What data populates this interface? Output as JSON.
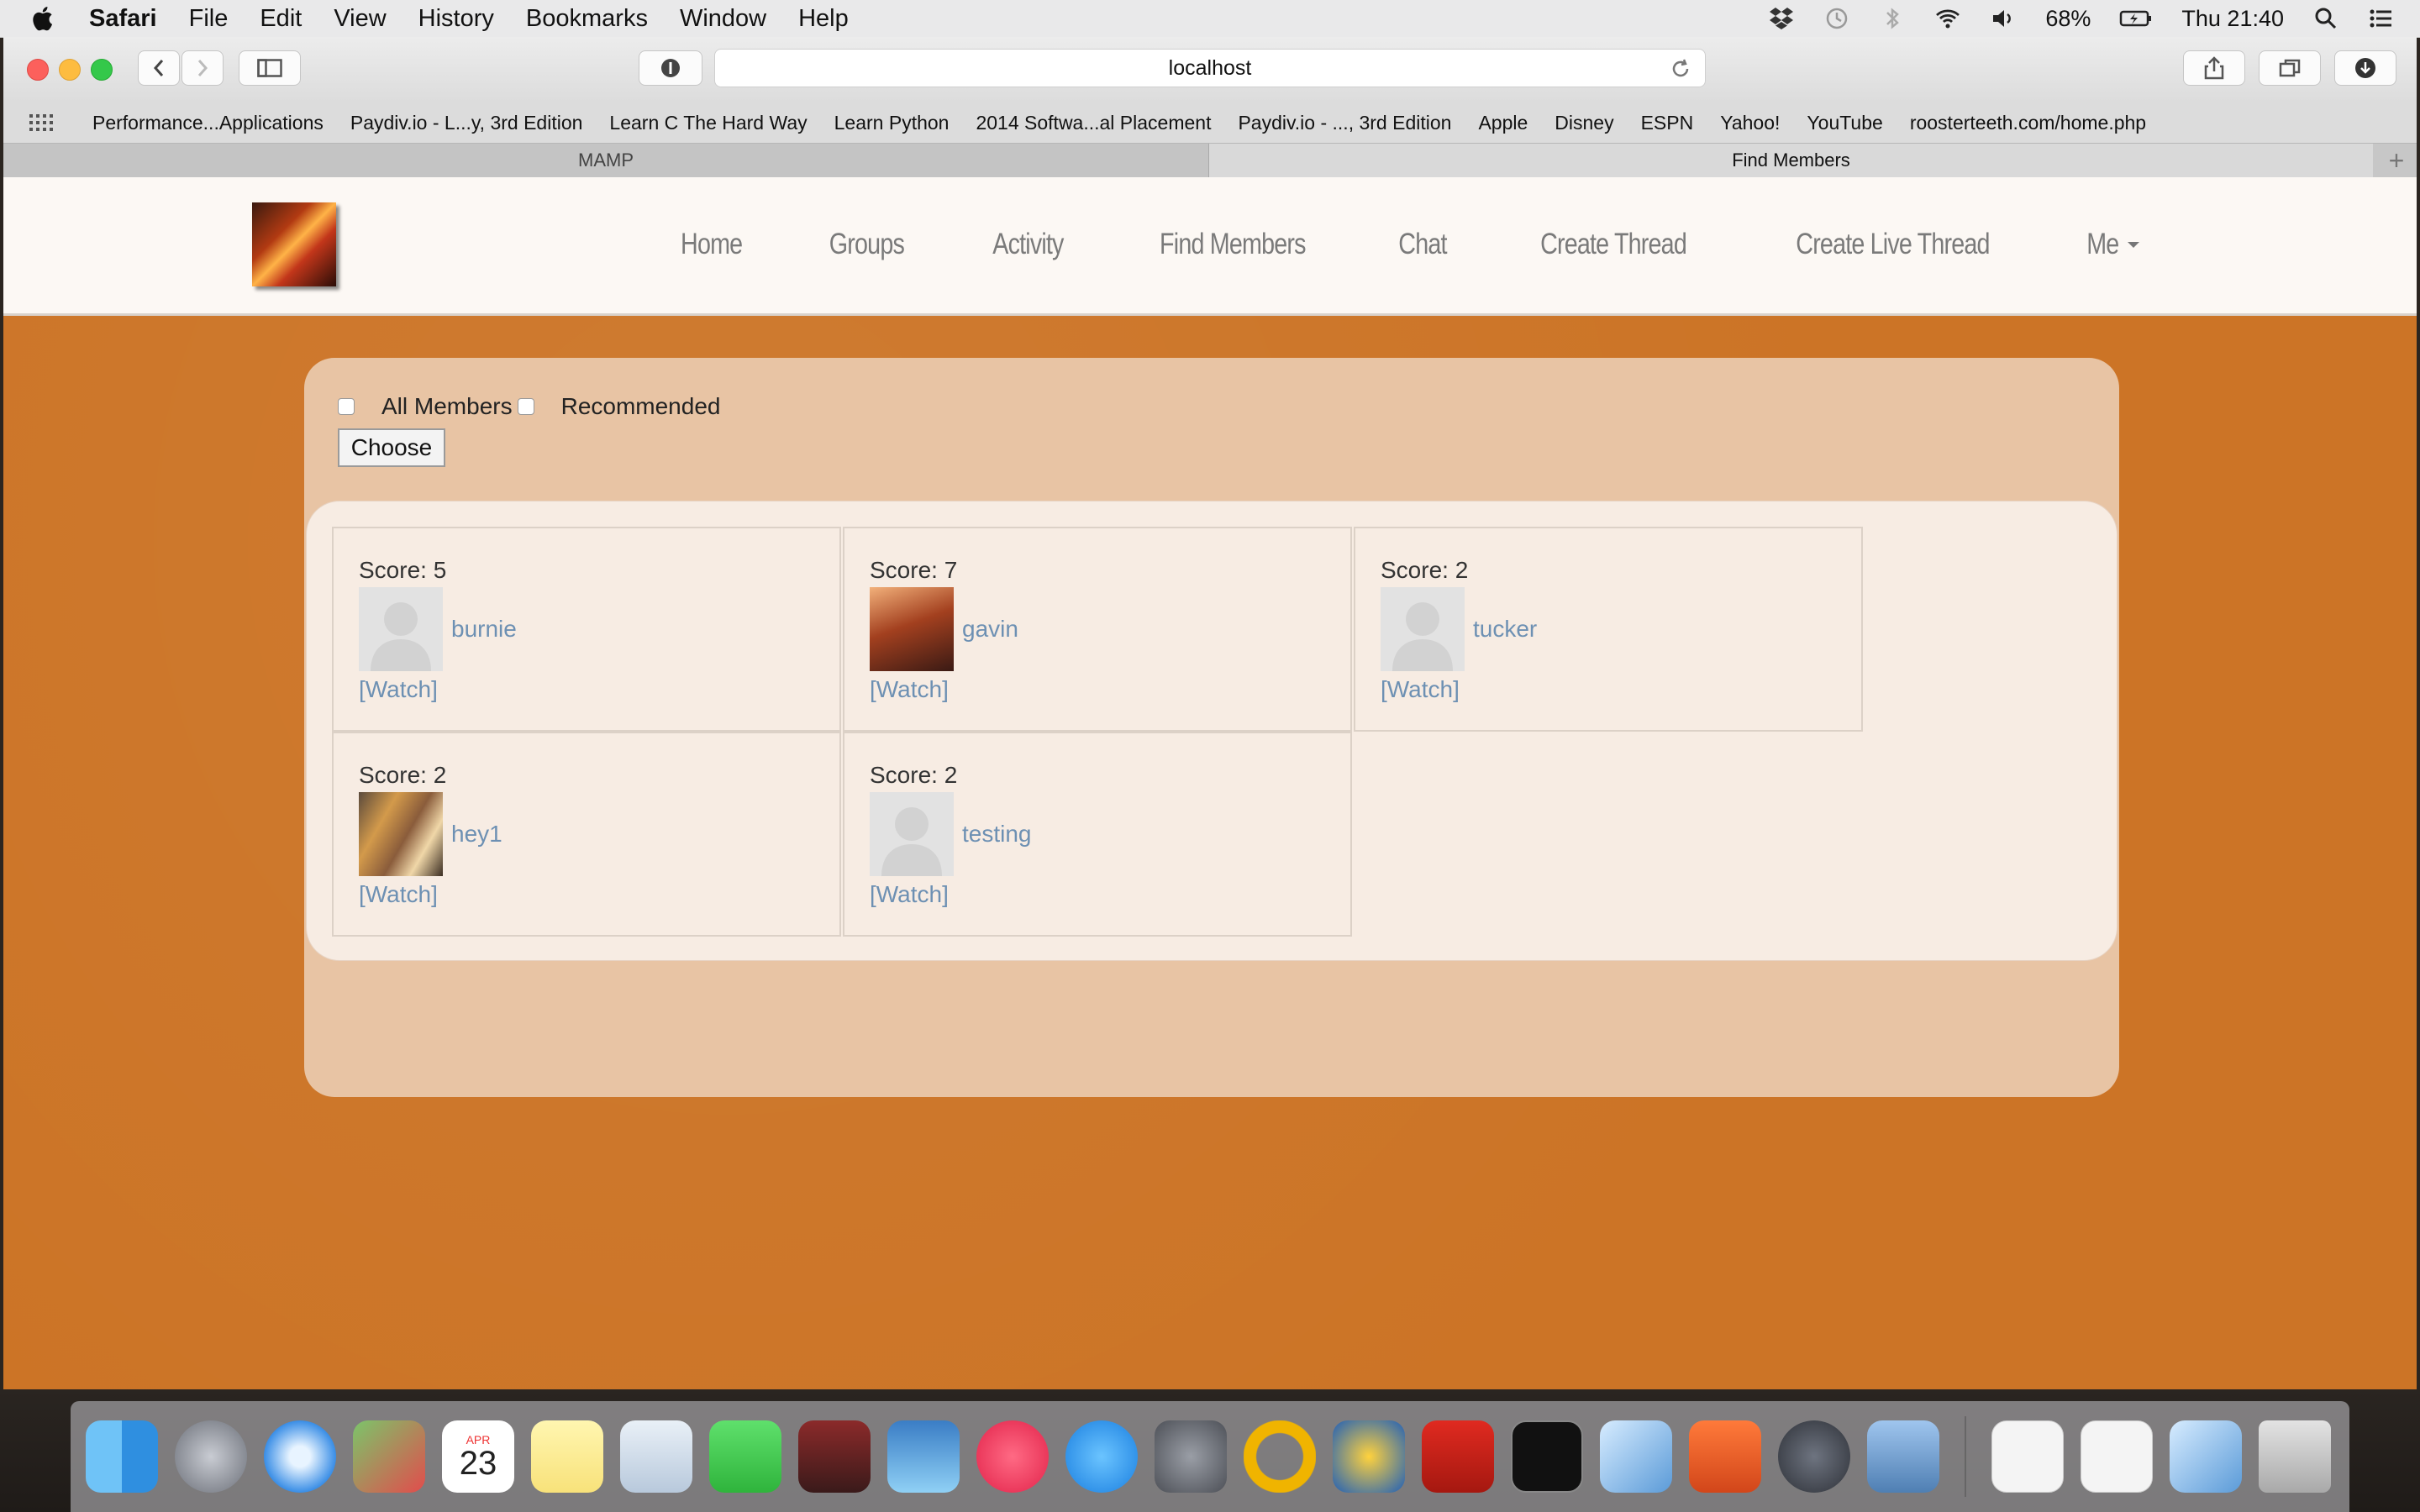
{
  "menubar": {
    "app_name": "Safari",
    "menus": [
      "File",
      "Edit",
      "View",
      "History",
      "Bookmarks",
      "Window",
      "Help"
    ],
    "battery": "68%",
    "clock": "Thu 21:40"
  },
  "browser": {
    "url": "localhost",
    "bookmarks": [
      "Performance...Applications",
      "Paydiv.io - L...y, 3rd Edition",
      "Learn C The Hard Way",
      "Learn Python",
      "2014 Softwa...al Placement",
      "Paydiv.io - ..., 3rd Edition",
      "Apple",
      "Disney",
      "ESPN",
      "Yahoo!",
      "YouTube",
      "roosterteeth.com/home.php"
    ],
    "tabs": [
      {
        "label": "MAMP"
      },
      {
        "label": "Find Members"
      }
    ],
    "new_tab_glyph": "+"
  },
  "site": {
    "nav": [
      "Home",
      "Groups",
      "Activity",
      "Find Members",
      "Chat",
      "Create Thread",
      "Create Live Thread",
      "Me"
    ]
  },
  "filters": {
    "all_members_label": "All Members",
    "recommended_label": "Recommended",
    "choose_label": "Choose"
  },
  "members": [
    {
      "score": "Score: 5",
      "name": "burnie",
      "watch": "[Watch]",
      "avatar": "default-avatar"
    },
    {
      "score": "Score: 7",
      "name": "gavin",
      "watch": "[Watch]",
      "avatar": "photo"
    },
    {
      "score": "Score: 2",
      "name": "tucker",
      "watch": "[Watch]",
      "avatar": "default-avatar"
    },
    {
      "score": "Score: 2",
      "name": "hey1",
      "watch": "[Watch]",
      "avatar": "photo"
    },
    {
      "score": "Score: 2",
      "name": "testing",
      "watch": "[Watch]",
      "avatar": "default-avatar"
    }
  ],
  "dock": {
    "calendar_month": "APR",
    "calendar_day": "23"
  },
  "colors": {
    "page_background": "#cc7426",
    "link": "#6d90b3",
    "panel": "#e8c4a4"
  }
}
